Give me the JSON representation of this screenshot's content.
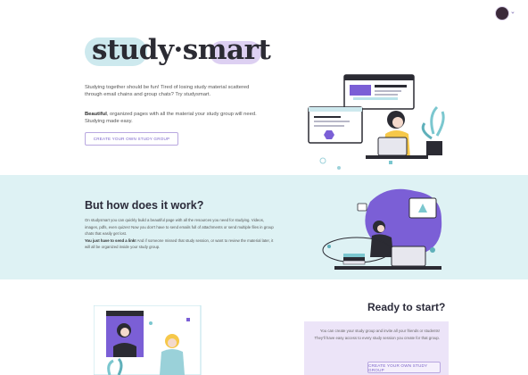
{
  "header": {
    "avatar_chevron": "⌄"
  },
  "hero": {
    "logo": "study·smart",
    "intro": "Studying together should be fun! Tired of losing study material scattered through email chains and group chats? Try studysmart.",
    "tagline_bold": "Beautiful",
    "tagline_rest": ", organized pages with all the material your study group will need. Studying made easy.",
    "cta_label": "CREATE YOUR OWN STUDY GROUP"
  },
  "how": {
    "title": "But how does it work?",
    "body": "On studysmart you can quickly build a beautiful page with all the resources you need for studying. Videos, images, pdfs, even quizes! Now you don't have to send emails full of attachments or send multiple files in group chats that easily get lost.",
    "body_bold": "You just have to send a link!",
    "body_rest": " And if someone missed that study session, or want to review the material later, it will all be organized inside your study group."
  },
  "ready": {
    "title": "Ready to start?",
    "body": "You can create your study group and invite all your friends or students! They'll have easy access to every study session you create for that group.",
    "cta_label": "CREATE YOUR OWN STUDY GROUP"
  },
  "colors": {
    "accent": "#7b5fd6",
    "mint": "#def2f4",
    "lavender": "#ece4f8",
    "ink": "#2b2b33"
  }
}
